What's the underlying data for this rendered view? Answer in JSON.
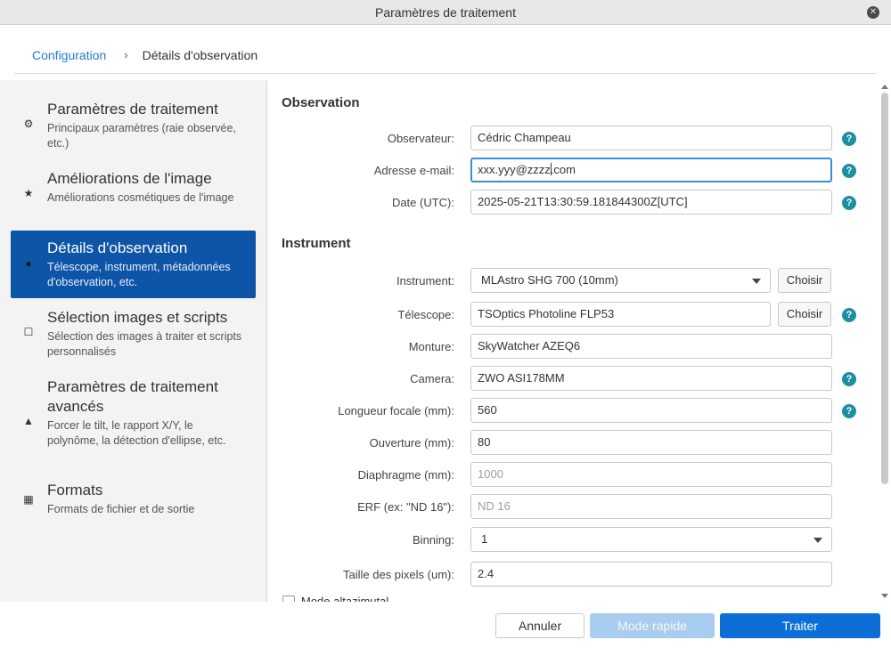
{
  "window": {
    "title": "Paramètres de traitement",
    "close_glyph": "✕"
  },
  "breadcrumb": {
    "root": "Configuration",
    "separator": "›",
    "current": "Détails d'observation"
  },
  "sidebar": {
    "items": [
      {
        "icon": "gear-icon",
        "glyph": "⚙",
        "title": "Paramètres de traitement",
        "description": "Principaux paramètres (raie observée, etc.)"
      },
      {
        "icon": "star-icon",
        "glyph": "★",
        "title": "Améliorations de l'image",
        "description": "Améliorations cosmétiques de l'image"
      },
      {
        "icon": "circle-icon",
        "glyph": "●",
        "title": "Détails d'observation",
        "description": "Télescope, instrument, métadonnées d'observation, etc."
      },
      {
        "icon": "square-icon",
        "glyph": "☐",
        "title": "Sélection images et scripts",
        "description": "Sélection des images à traiter et scripts personnalisés"
      },
      {
        "icon": "triangle-icon",
        "glyph": "▲",
        "title": "Paramètres de traitement avancés",
        "description": "Forcer le tilt, le rapport X/Y, le polynôme, la détection d'ellipse, etc."
      },
      {
        "icon": "grid-icon",
        "glyph": "▦",
        "title": "Formats",
        "description": "Formats de fichier et de sortie"
      }
    ]
  },
  "observation": {
    "title": "Observation",
    "observer_label": "Observateur:",
    "observer_value": "Cédric Champeau",
    "email_label": "Adresse e-mail:",
    "email_before_caret": "xxx.yyy@zzzz",
    "email_after_caret": ".com",
    "date_label": "Date (UTC):",
    "date_value": "2025-05-21T13:30:59.181844300Z[UTC]"
  },
  "instrument": {
    "title": "Instrument",
    "instrument_label": "Instrument:",
    "instrument_value": "MLAstro SHG 700 (10mm)",
    "choose_label": "Choisir",
    "telescope_label": "Télescope:",
    "telescope_value": "TSOptics Photoline FLP53",
    "mount_label": "Monture:",
    "mount_value": "SkyWatcher AZEQ6",
    "camera_label": "Camera:",
    "camera_value": "ZWO ASI178MM",
    "focal_label": "Longueur focale (mm):",
    "focal_value": "560",
    "aperture_label": "Ouverture (mm):",
    "aperture_value": "80",
    "diaphragm_label": "Diaphragme (mm):",
    "diaphragm_placeholder": "1000",
    "erf_label": "ERF (ex: \"ND 16\"):",
    "erf_placeholder": "ND 16",
    "binning_label": "Binning:",
    "binning_value": "1",
    "pixel_label": "Taille des pixels (um):",
    "pixel_value": "2.4",
    "altaz_label": "Mode altazimutal"
  },
  "help_glyph": "?",
  "footer": {
    "cancel": "Annuler",
    "quick": "Mode rapide",
    "process": "Traiter"
  },
  "colors": {
    "accent": "#0d6fd6",
    "active_nav": "#0e55a8",
    "help": "#1e8fa2",
    "link": "#1f7ccf"
  }
}
